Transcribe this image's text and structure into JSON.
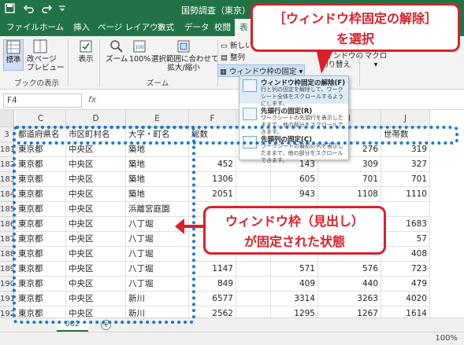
{
  "titlebar": {
    "title": "国勢調査（東京）.xlsx",
    "save_icon": "save-icon",
    "undo_icon": "undo-icon",
    "redo_icon": "redo-icon",
    "customize_icon": "customize-icon"
  },
  "tabs": [
    "ファイル",
    "ホーム",
    "挿入",
    "ページ レイアウト",
    "数式",
    "データ",
    "校閲",
    "表"
  ],
  "ribbon": {
    "view_modes": {
      "normal": "標準",
      "page_break_1": "改ページ",
      "page_break_2": "プレビュー",
      "group_label": "ブックの表示"
    },
    "show": "表示",
    "zoom": {
      "zoom": "ズーム",
      "zoom100": "100%",
      "fit_1": "選択範囲に合わせて",
      "fit_2": "拡大/縮小",
      "group_label": "ズーム"
    },
    "window": {
      "new_window": "新しいウ",
      "arrange": "整列",
      "freeze": "ウィンドウ枠の固定",
      "switch_1": "ウィンドウの",
      "switch_2": "切り替え"
    },
    "macro": "マクロ"
  },
  "dropdown": [
    {
      "title": "ウィンドウ枠固定の解除(F)",
      "desc": "行と列の固定を解除して、ワークシート全体をスクロールするようにします。"
    },
    {
      "title": "先頭行の固定(R)",
      "desc": "ワークシートの先頭行を表示したままで、他の部分をスクロールできます。"
    },
    {
      "title": "先頭列の固定(C)",
      "desc": "ワークシートの最初の列を表示したままで、他の部分をスクロールできます。"
    }
  ],
  "formula_bar": {
    "name_box": "F4",
    "fx": "fx"
  },
  "columns": [
    "C",
    "D",
    "E",
    "F",
    "G",
    "H",
    "I",
    "J"
  ],
  "header_row": {
    "row": "3",
    "cells": [
      "都道府県名",
      "市区町村名",
      "大字・町名",
      "総数",
      "",
      "",
      "",
      "世帯数"
    ]
  },
  "rows": [
    {
      "row": "181",
      "cells": [
        "東京都",
        "中央区",
        "築地",
        "",
        "",
        "",
        "276",
        "319"
      ]
    },
    {
      "row": "182",
      "cells": [
        "東京都",
        "中央区",
        "築地",
        "452",
        "",
        "143",
        "309",
        "327"
      ]
    },
    {
      "row": "183",
      "cells": [
        "東京都",
        "中央区",
        "築地",
        "1306",
        "",
        "605",
        "701",
        "701"
      ]
    },
    {
      "row": "184",
      "cells": [
        "東京都",
        "中央区",
        "築地",
        "2051",
        "",
        "943",
        "1108",
        "1110"
      ]
    },
    {
      "row": "185",
      "cells": [
        "東京都",
        "中央区",
        "浜離宮庭園",
        "",
        "",
        "",
        "",
        ""
      ]
    },
    {
      "row": "186",
      "cells": [
        "東京都",
        "中央区",
        "八丁堀",
        "",
        "",
        "",
        "",
        "1683"
      ]
    },
    {
      "row": "187",
      "cells": [
        "東京都",
        "中央区",
        "八丁堀",
        "",
        "",
        "",
        "",
        "57"
      ]
    },
    {
      "row": "188",
      "cells": [
        "東京都",
        "中央区",
        "八丁堀",
        "",
        "",
        "",
        "",
        "408"
      ]
    },
    {
      "row": "189",
      "cells": [
        "東京都",
        "中央区",
        "八丁堀",
        "1147",
        "",
        "571",
        "576",
        "723"
      ]
    },
    {
      "row": "190",
      "cells": [
        "東京都",
        "中央区",
        "八丁堀",
        "849",
        "",
        "409",
        "440",
        "479"
      ]
    },
    {
      "row": "191",
      "cells": [
        "東京都",
        "中央区",
        "新川",
        "6577",
        "",
        "3314",
        "3263",
        "4020"
      ]
    },
    {
      "row": "192",
      "cells": [
        "東京都",
        "中央区",
        "新川",
        "2562",
        "",
        "1295",
        "1267",
        "1614"
      ]
    },
    {
      "row": "193",
      "cells": [
        "東京都",
        "中央区",
        "新川",
        "4015",
        "",
        "2019",
        "1996",
        "2414"
      ]
    }
  ],
  "sheet_tab": "002",
  "add_sheet": "+",
  "zoom_level": "100%",
  "callouts": {
    "top_1": "［ウィンドウ枠固定の解除］",
    "top_2": "を選択",
    "middle_1": "ウィンドウ枠（見出し）",
    "middle_2": "が固定された状態"
  },
  "colors": {
    "excel_green": "#217346",
    "callout_red": "#d9212b",
    "dotted_blue": "#1976d2"
  }
}
